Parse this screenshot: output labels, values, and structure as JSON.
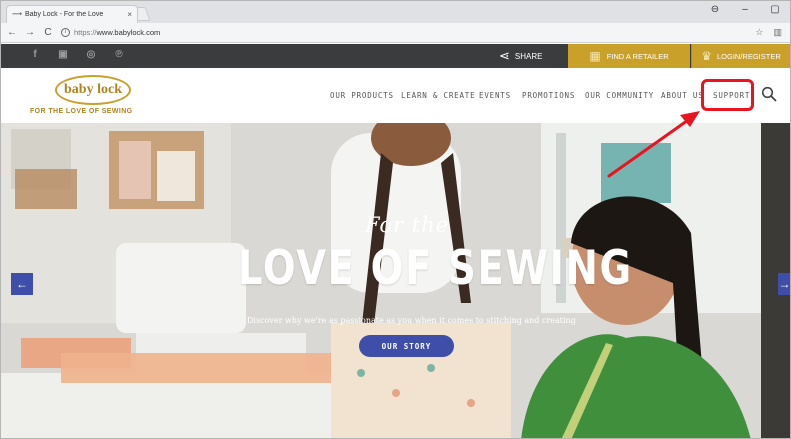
{
  "browser": {
    "tab_title": "Baby Lock - For the Love",
    "tab_close": "×",
    "url_protocol": "https://",
    "url_host": "www.babylock.com",
    "win_controls": [
      "⊖",
      "–",
      "▢"
    ],
    "addr_icons": [
      "☆",
      "▥"
    ]
  },
  "topbar": {
    "share_label": "SHARE",
    "retailer_label": "FIND A RETAILER",
    "login_label": "LOGIN/REGISTER",
    "social_icons": [
      "facebook-icon",
      "youtube-icon",
      "instagram-icon",
      "pinterest-icon"
    ]
  },
  "nav": {
    "logo_text": "baby lock",
    "tagline": "FOR THE LOVE OF SEWING",
    "items": [
      "OUR PRODUCTS",
      "LEARN & CREATE",
      "EVENTS",
      "PROMOTIONS",
      "OUR COMMUNITY",
      "ABOUT US",
      "SUPPORT"
    ]
  },
  "hero": {
    "script_text": "For the",
    "title": "LOVE OF SEWING",
    "subtitle": "Discover why we're as passionate as you when it comes to stitching and creating",
    "button_label": "OUR STORY",
    "prev_arrow": "←",
    "next_arrow": "→"
  },
  "colors": {
    "gold": "#c8a02a",
    "topbar": "#3b3c3e",
    "accent_blue": "#3f4ea9",
    "annotation_red": "#e8141f"
  }
}
